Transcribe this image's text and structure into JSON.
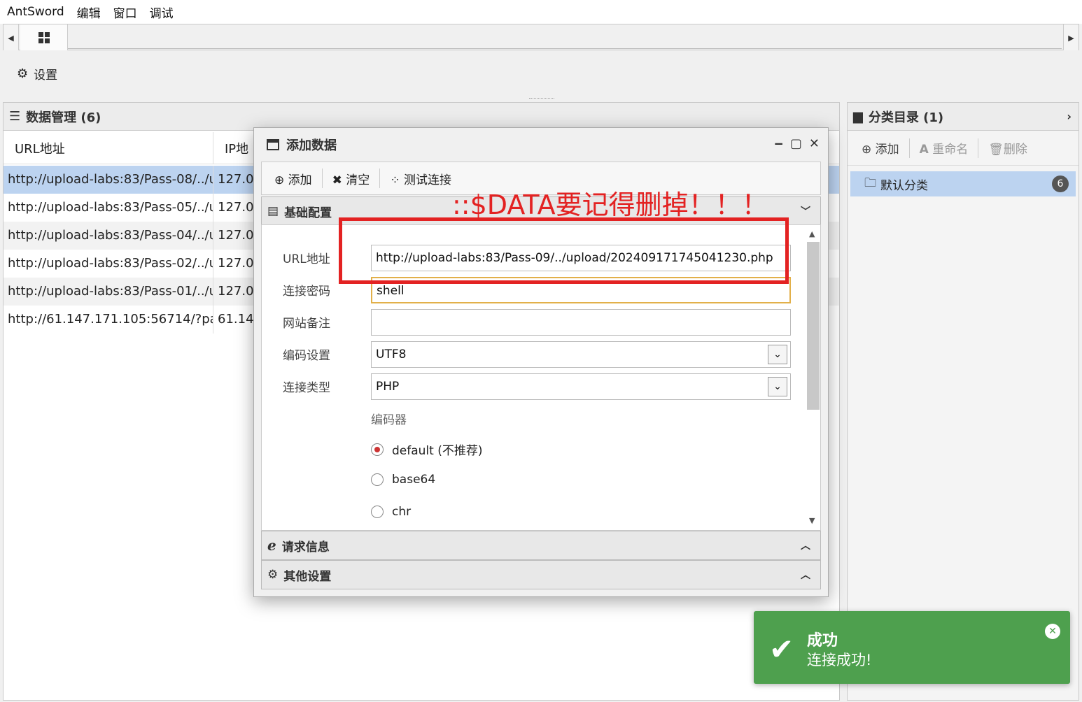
{
  "menubar": {
    "items": [
      "AntSword",
      "编辑",
      "窗口",
      "调试"
    ]
  },
  "toolbar": {
    "settings_label": "设置"
  },
  "data_panel": {
    "title": "数据管理 (6)",
    "columns": [
      "URL地址",
      "IP地"
    ],
    "rows": [
      {
        "url": "http://upload-labs:83/Pass-08/../u",
        "ip": "127.0"
      },
      {
        "url": "http://upload-labs:83/Pass-05/../u",
        "ip": "127.0"
      },
      {
        "url": "http://upload-labs:83/Pass-04/../u",
        "ip": "127.0"
      },
      {
        "url": "http://upload-labs:83/Pass-02/../u",
        "ip": "127.0"
      },
      {
        "url": "http://upload-labs:83/Pass-01/../u",
        "ip": "127.0"
      },
      {
        "url": "http://61.147.171.105:56714/?pa(",
        "ip": "61.14"
      }
    ]
  },
  "category_panel": {
    "title": "分类目录 (1)",
    "add_label": "添加",
    "rename_label": "重命名",
    "delete_label": "删除",
    "items": [
      {
        "label": "默认分类",
        "count": "6"
      }
    ]
  },
  "dialog": {
    "title": "添加数据",
    "toolbar": {
      "add": "添加",
      "clear": "清空",
      "test": "测试连接"
    },
    "section_basic": "基础配置",
    "section_request": "请求信息",
    "section_other": "其他设置",
    "fields": {
      "url_label": "URL地址",
      "url_value": "http://upload-labs:83/Pass-09/../upload/202409171745041230.php",
      "password_label": "连接密码",
      "password_value": "shell",
      "note_label": "网站备注",
      "note_value": "",
      "encoding_label": "编码设置",
      "encoding_value": "UTF8",
      "type_label": "连接类型",
      "type_value": "PHP",
      "encoder_label": "编码器",
      "encoders": [
        "default (不推荐)",
        "base64",
        "chr"
      ]
    }
  },
  "annotation": {
    "text": "::$DATA要记得删掉！！！",
    "color": "#e32222"
  },
  "toast": {
    "title": "成功",
    "message": "连接成功!",
    "color": "#4ea04e"
  }
}
